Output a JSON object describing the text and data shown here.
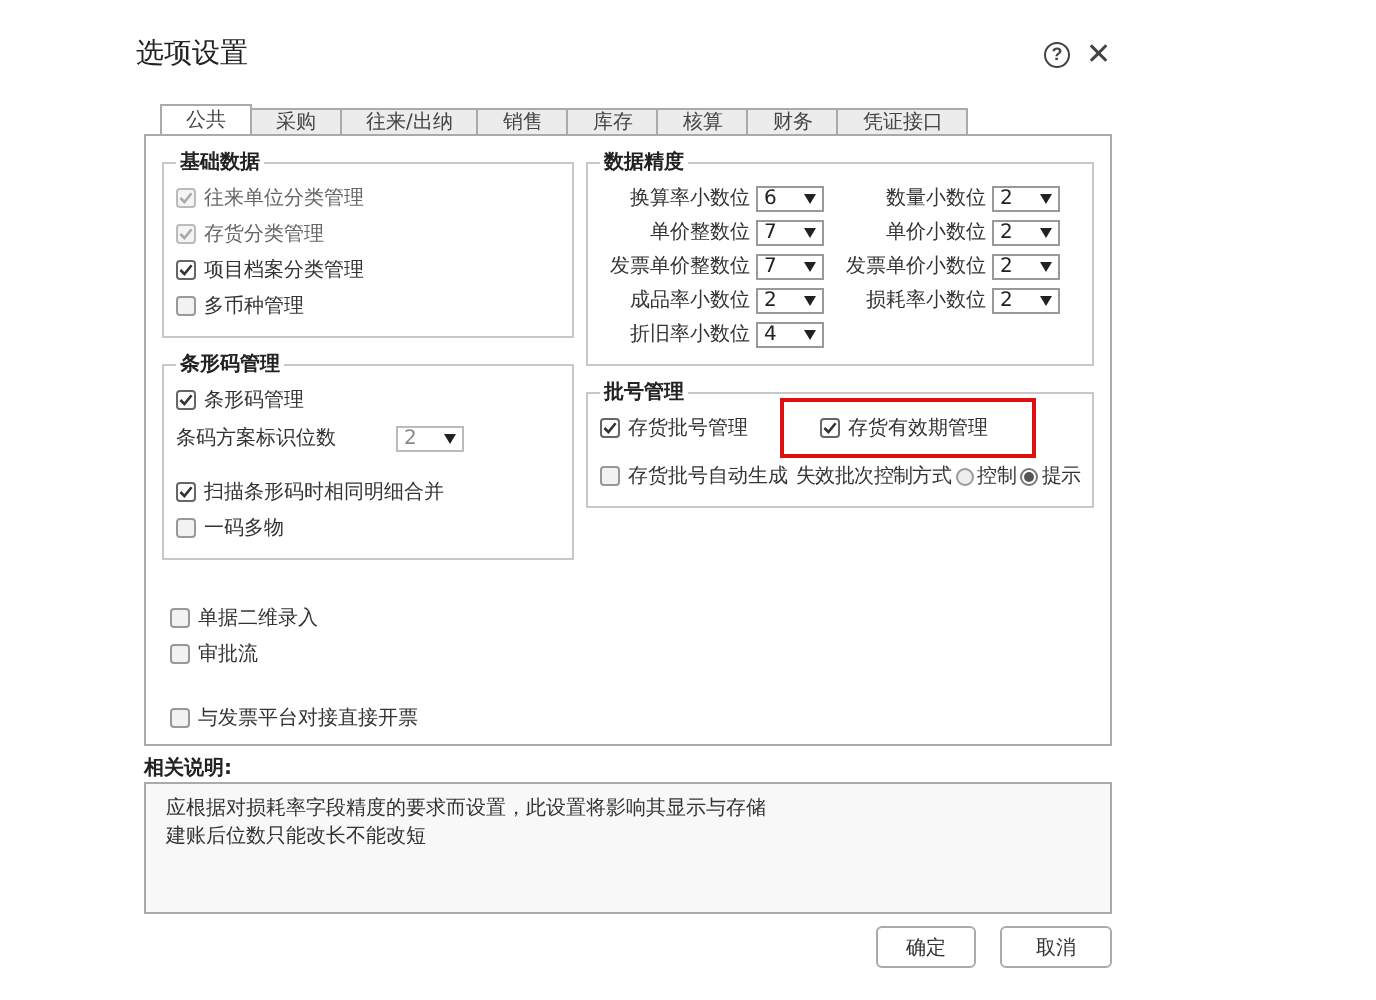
{
  "window": {
    "title": "选项设置",
    "help": "?",
    "close": "✕"
  },
  "tabs": [
    {
      "label": "公共",
      "selected": true
    },
    {
      "label": "采购",
      "selected": false
    },
    {
      "label": "往来/出纳",
      "selected": false
    },
    {
      "label": "销售",
      "selected": false
    },
    {
      "label": "库存",
      "selected": false
    },
    {
      "label": "核算",
      "selected": false
    },
    {
      "label": "财务",
      "selected": false
    },
    {
      "label": "凭证接口",
      "selected": false
    }
  ],
  "basic_data": {
    "title": "基础数据",
    "items": [
      {
        "label": "往来单位分类管理",
        "checked": true,
        "disabled": true
      },
      {
        "label": "存货分类管理",
        "checked": true,
        "disabled": true
      },
      {
        "label": "项目档案分类管理",
        "checked": true,
        "disabled": false
      },
      {
        "label": "多币种管理",
        "checked": false,
        "disabled": false
      }
    ]
  },
  "barcode": {
    "title": "条形码管理",
    "items": [
      {
        "kind": "checkbox",
        "label": "条形码管理",
        "checked": true
      },
      {
        "kind": "select",
        "label": "条码方案标识位数",
        "value": "2"
      },
      {
        "kind": "checkbox",
        "label": "扫描条形码时相同明细合并",
        "checked": true
      },
      {
        "kind": "checkbox",
        "label": "一码多物",
        "checked": false
      }
    ]
  },
  "precision": {
    "title": "数据精度",
    "fields": [
      {
        "label": "换算率小数位",
        "value": "6"
      },
      {
        "label": "数量小数位",
        "value": "2"
      },
      {
        "label": "单价整数位",
        "value": "7"
      },
      {
        "label": "单价小数位",
        "value": "2"
      },
      {
        "label": "发票单价整数位",
        "value": "7"
      },
      {
        "label": "发票单价小数位",
        "value": "2"
      },
      {
        "label": "成品率小数位",
        "value": "2"
      },
      {
        "label": "损耗率小数位",
        "value": "2"
      },
      {
        "label": "折旧率小数位",
        "value": "4"
      }
    ]
  },
  "batch": {
    "title": "批号管理",
    "items": [
      {
        "kind": "checkbox",
        "label": "存货批号管理",
        "checked": true,
        "highlighted": false
      },
      {
        "kind": "checkbox",
        "label": "存货有效期管理",
        "checked": true,
        "highlighted": true
      },
      {
        "kind": "checkbox",
        "label": "存货批号自动生成",
        "checked": false,
        "highlighted": false
      },
      {
        "kind": "radio",
        "label": "失效批次控制方式",
        "options": [
          {
            "label": "控制",
            "selected": false
          },
          {
            "label": "提示",
            "selected": true
          }
        ]
      }
    ]
  },
  "extra_options": [
    {
      "label": "单据二维录入",
      "checked": false
    },
    {
      "label": "审批流",
      "checked": false
    }
  ],
  "invoice_option": {
    "label": "与发票平台对接直接开票",
    "checked": false
  },
  "notes": {
    "title": "相关说明:",
    "lines": [
      "应根据对损耗率字段精度的要求而设置，此设置将影响其显示与存储",
      "建账后位数只能改长不能改短"
    ]
  },
  "buttons": [
    "确定",
    "取消"
  ]
}
